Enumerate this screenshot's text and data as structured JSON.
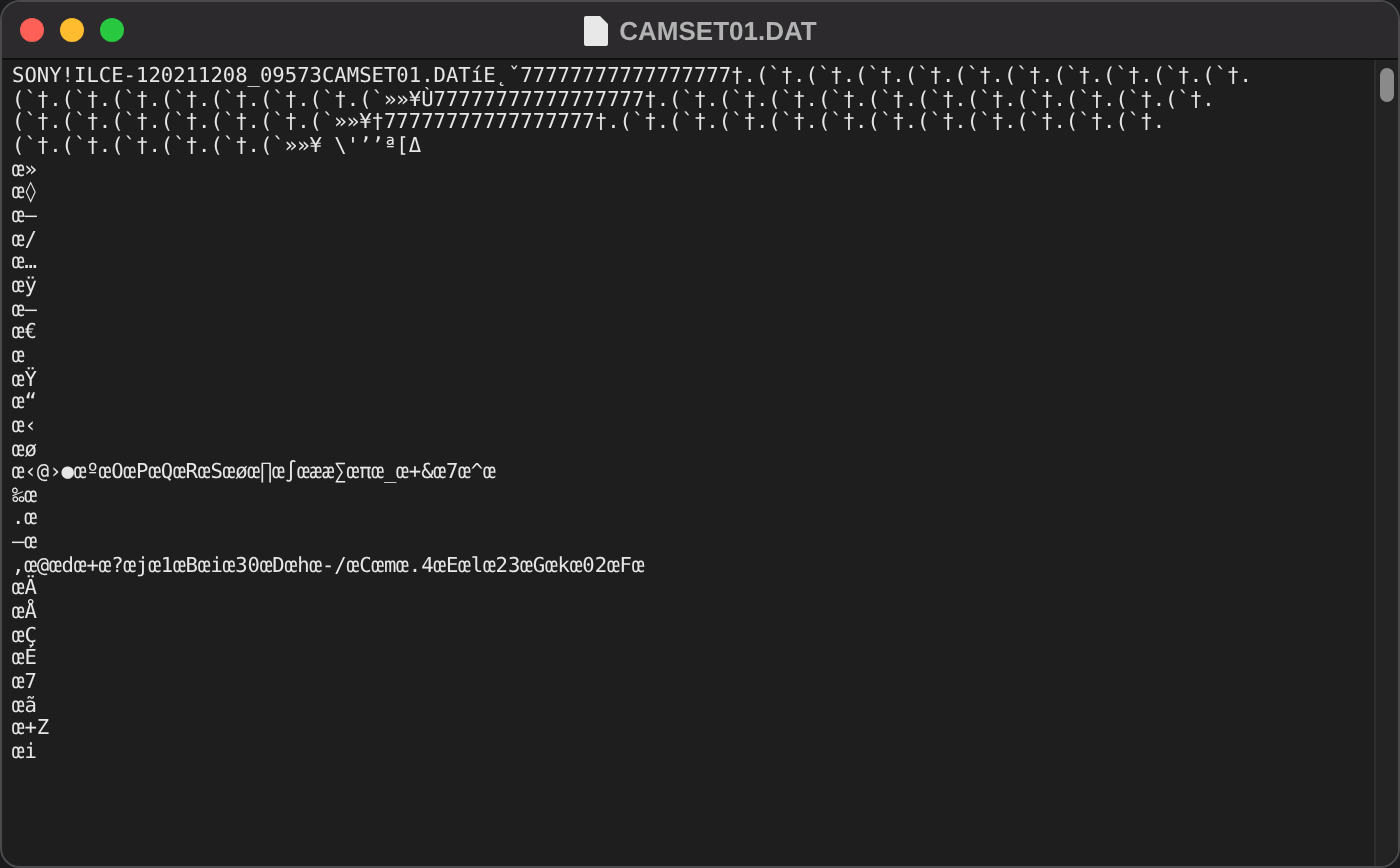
{
  "window": {
    "title": "CAMSET01.DAT"
  },
  "document": {
    "lines": [
      "SONY!ILCE-120211208_09573CAMSET01.DATíE˛ˇ77777777777777777†.(`†.(`†.(`†.(`†.(`†.(`†.(`†.(`†.(`†.(`†.",
      "(`†.(`†.(`†.(`†.(`†.(`†.(`†.(`»»¥Ù77777777777777777†.(`†.(`†.(`†.(`†.(`†.(`†.(`†.(`†.(`†.(`†.(`†.",
      "(`†.(`†.(`†.(`†.(`†.(`†.(`»»¥†77777777777777777†.(`†.(`†.(`†.(`†.(`†.(`†.(`†.(`†.(`†.(`†.(`†.",
      "(`†.(`†.(`†.(`†.(`†.(`»»¥ \\'’’ª[Δ",
      "œ»",
      "œ◊",
      "œ—",
      "œ/",
      "œ…",
      "œÿ",
      "œ—",
      "œ€",
      "œ",
      "œŸ",
      "œ“",
      "œ‹",
      "œø",
      "œ‹@›●œºœOœPœQœRœSœøœ∏œ∫œææ∑œπœ_œ+&œ7œ^œ",
      "‰œ",
      ".œ",
      "—œ",
      ",œ@œdœ+œ?œjœ1œBœiœ30œDœhœ-/œCœmœ.4œEœlœ23œGœkœ02œFœ",
      "œÄ",
      "œÅ",
      "œÇ",
      "œÉ",
      "œ7",
      "œã",
      "œ+Z",
      "œi"
    ]
  }
}
